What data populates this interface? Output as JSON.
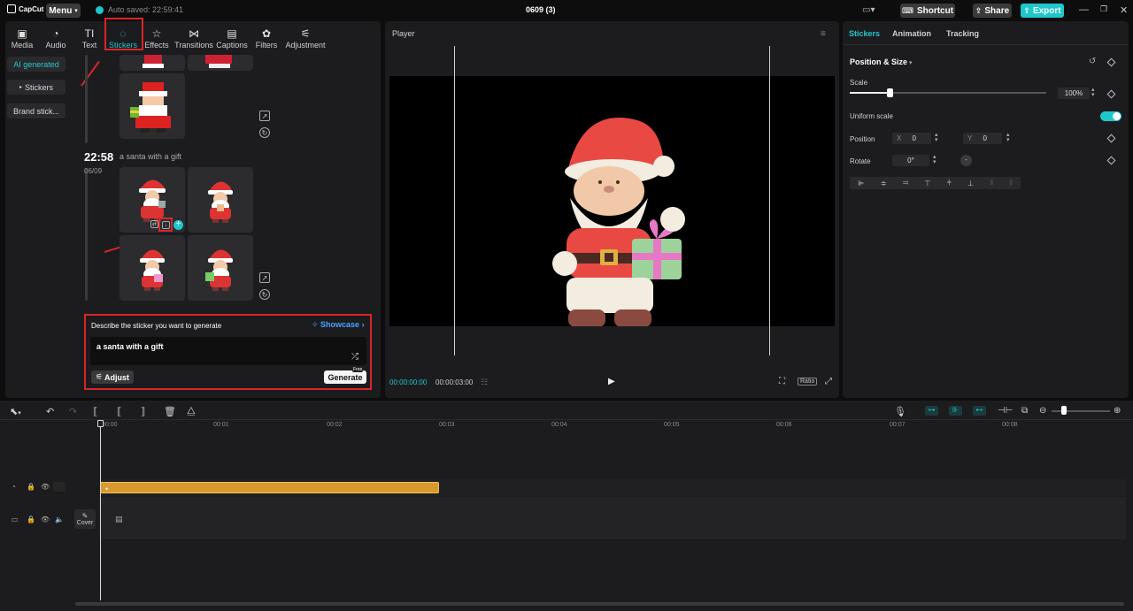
{
  "app": {
    "name": "CapCut",
    "menu": "Menu",
    "saved_status": "Auto saved: 22:59:41",
    "project_title": "0609 (3)"
  },
  "titlebar": {
    "shortcut": "Shortcut",
    "share": "Share",
    "export": "Export"
  },
  "tools": [
    {
      "label": "Media",
      "icon": "media-icon"
    },
    {
      "label": "Audio",
      "icon": "audio-icon"
    },
    {
      "label": "Text",
      "icon": "text-icon"
    },
    {
      "label": "Stickers",
      "icon": "stickers-icon",
      "active": true
    },
    {
      "label": "Effects",
      "icon": "effects-icon"
    },
    {
      "label": "Transitions",
      "icon": "transitions-icon"
    },
    {
      "label": "Captions",
      "icon": "captions-icon"
    },
    {
      "label": "Filters",
      "icon": "filters-icon"
    },
    {
      "label": "Adjustment",
      "icon": "adjustment-icon"
    }
  ],
  "sidebar": {
    "items": [
      {
        "label": "AI generated",
        "active": true
      },
      {
        "label": "Stickers"
      },
      {
        "label": "Brand stick..."
      }
    ]
  },
  "history": {
    "time": "22:58",
    "prompt": "a santa with a gift",
    "date": "06/09"
  },
  "generator": {
    "title": "Describe the sticker you want to generate",
    "showcase": "Showcase",
    "prompt_value": "a santa with a gift",
    "adjust": "Adjust",
    "generate": "Generate",
    "badge": "Free"
  },
  "player": {
    "title": "Player",
    "current_time": "00:00:00:00",
    "total_time": "00:00:03:00",
    "ratio": "Ratio"
  },
  "inspector": {
    "tabs": [
      "Stickers",
      "Animation",
      "Tracking"
    ],
    "section": "Position & Size",
    "scale_label": "Scale",
    "scale_value": "100%",
    "scale_level": 0.3,
    "uniform_scale": "Uniform scale",
    "uniform_scale_on": true,
    "position_label": "Position",
    "x_label": "X",
    "x_value": "0",
    "y_label": "Y",
    "y_value": "0",
    "rotate_label": "Rotate",
    "rotate_value": "0°"
  },
  "timeline": {
    "ruler": [
      "00:00",
      "00:01",
      "00:02",
      "00:03",
      "00:04",
      "00:05",
      "00:06",
      "00:07",
      "00:08"
    ],
    "cover_label": "Cover"
  },
  "colors": {
    "accent": "#1fc7cc",
    "highlight": "#d9252a",
    "clip": "#d89a2e"
  }
}
